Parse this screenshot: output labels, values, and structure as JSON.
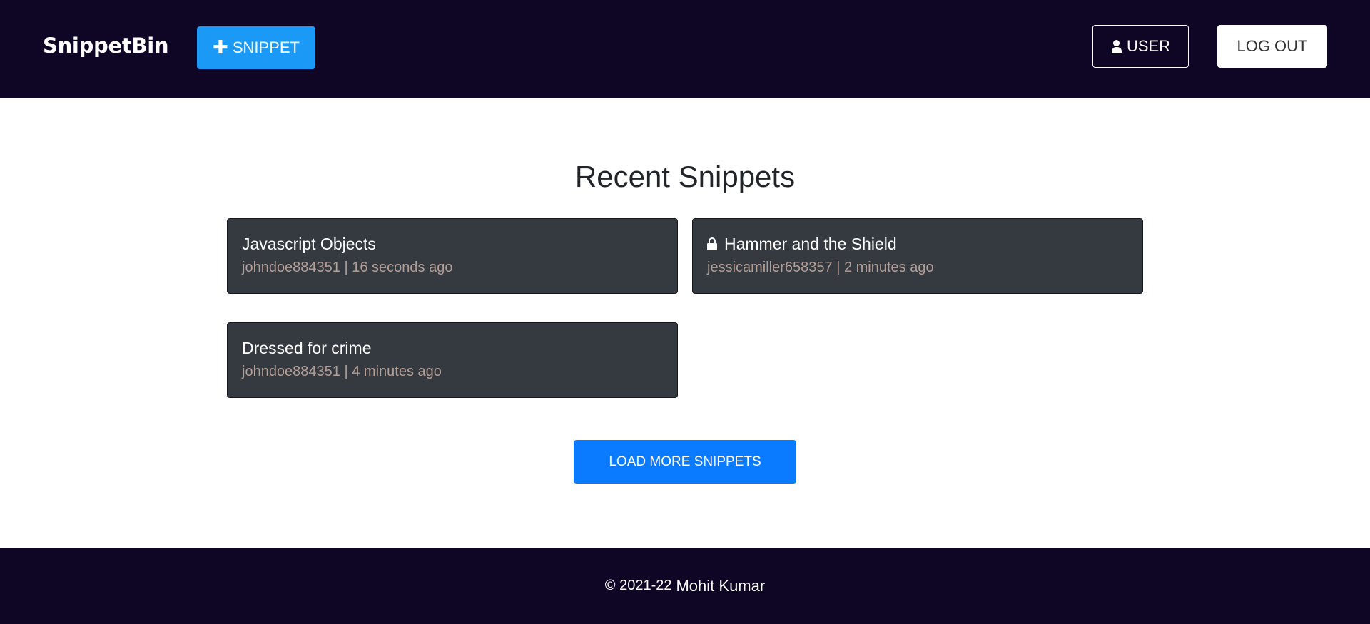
{
  "header": {
    "brand": "SnippetBin",
    "new_snippet_label": "SNIPPET",
    "user_label": "USER",
    "logout_label": "LOG OUT"
  },
  "main": {
    "title": "Recent Snippets",
    "snippets": [
      {
        "title": "Javascript Objects",
        "meta": "johndoe884351 | 16 seconds ago",
        "private": false
      },
      {
        "title": "Hammer and the Shield",
        "meta": "jessicamiller658357 | 2 minutes ago",
        "private": true
      },
      {
        "title": "Dressed for crime",
        "meta": "johndoe884351 | 4 minutes ago",
        "private": false
      }
    ],
    "load_more_label": "LOAD MORE SNIPPETS"
  },
  "footer": {
    "copyright": "© 2021-22",
    "author": "Mohit Kumar"
  },
  "colors": {
    "nav_background": "#0f0524",
    "primary_button": "#1a9af6",
    "load_more_button": "#0a7bff",
    "card_background": "#343a40",
    "card_meta_text": "#b39e96"
  }
}
